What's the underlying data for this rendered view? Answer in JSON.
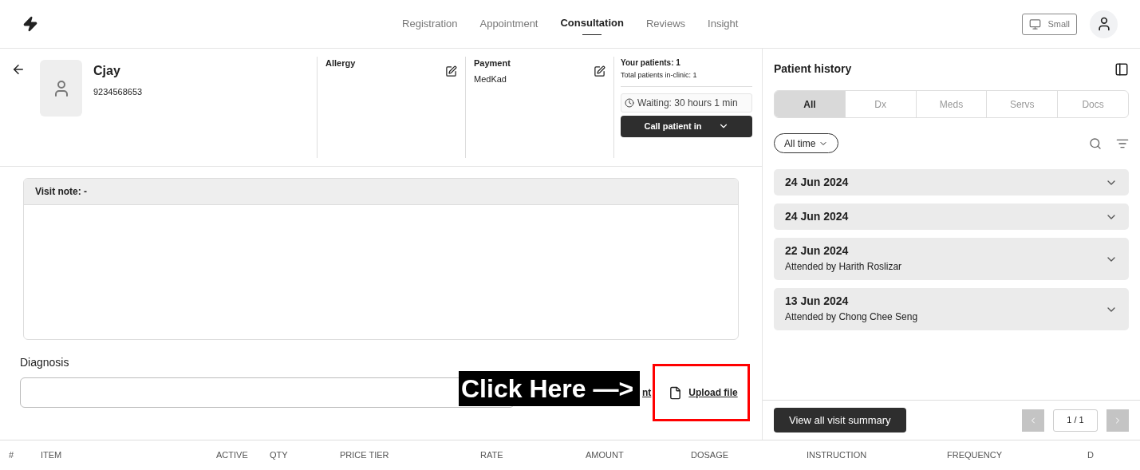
{
  "nav": {
    "tabs": [
      {
        "label": "Registration",
        "selected": false
      },
      {
        "label": "Appointment",
        "selected": false
      },
      {
        "label": "Consultation",
        "selected": true
      },
      {
        "label": "Reviews",
        "selected": false
      },
      {
        "label": "Insight",
        "selected": false
      }
    ],
    "size_button": "Small"
  },
  "patient": {
    "name": "Cjay",
    "phone": "9234568653"
  },
  "allergy": {
    "label": "Allergy"
  },
  "payment": {
    "label": "Payment",
    "value": "MedKad"
  },
  "queue": {
    "your_patients": "Your patients: 1",
    "total": "Total patients in-clinic: 1",
    "waiting": "Waiting: 30 hours 1 min",
    "call_button": "Call patient in"
  },
  "visit_note": {
    "title": "Visit note: -"
  },
  "diagnosis": {
    "label": "Diagnosis",
    "hidden_link": "nt",
    "upload": "Upload file"
  },
  "annotation": {
    "text": "Click Here —>"
  },
  "history": {
    "title": "Patient history",
    "tabs": [
      {
        "label": "All",
        "selected": true
      },
      {
        "label": "Dx",
        "selected": false
      },
      {
        "label": "Meds",
        "selected": false
      },
      {
        "label": "Servs",
        "selected": false
      },
      {
        "label": "Docs",
        "selected": false
      }
    ],
    "filter": "All time",
    "visits": [
      {
        "date": "24 Jun 2024"
      },
      {
        "date": "24 Jun 2024"
      },
      {
        "date": "22 Jun 2024",
        "doctor": "Attended by Harith Roslizar"
      },
      {
        "date": "13 Jun 2024",
        "doctor": "Attended by Chong Chee Seng"
      }
    ],
    "summary_button": "View all visit summary",
    "page": "1 / 1"
  },
  "table": {
    "columns": [
      "#",
      "ITEM",
      "ACTIVE",
      "QTY",
      "PRICE TIER",
      "RATE",
      "AMOUNT",
      "DOSAGE",
      "INSTRUCTION",
      "FREQUENCY",
      "D"
    ]
  }
}
